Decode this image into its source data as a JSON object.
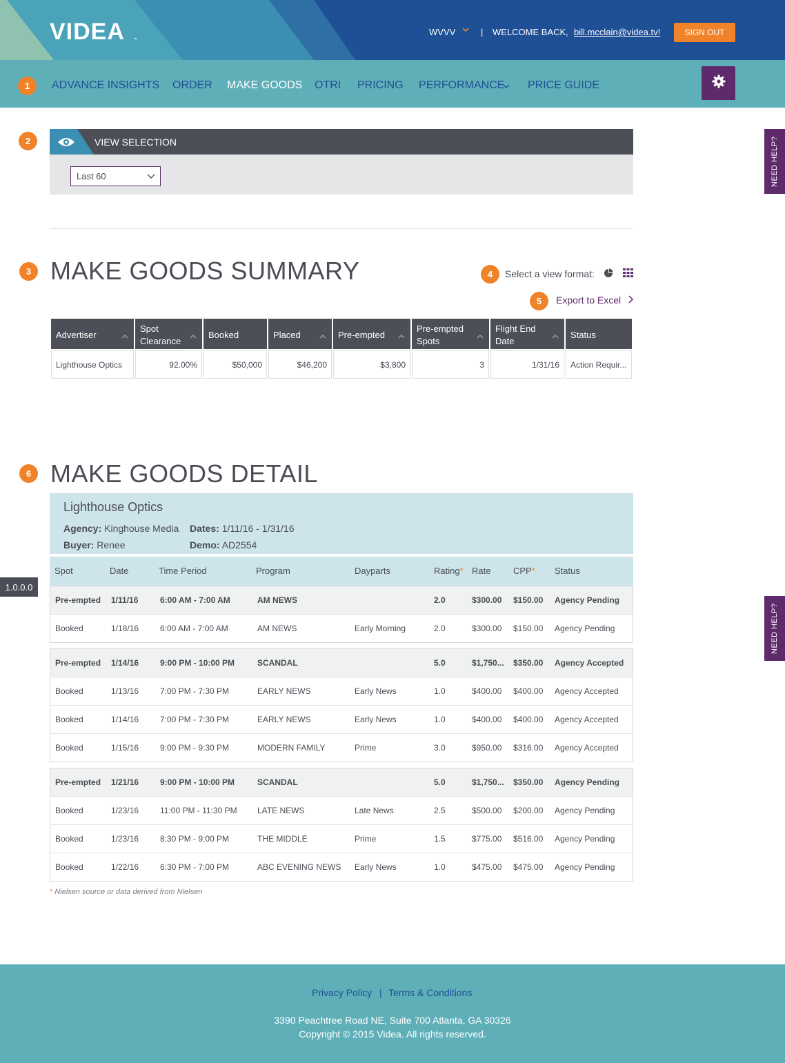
{
  "header": {
    "logo": "VIDEA",
    "logo_tm": "™",
    "station": "WVVV",
    "separator": "|",
    "welcome": "WELCOME BACK,",
    "email": "bill.mcclain@videa.tv!",
    "signout": "SIGN OUT"
  },
  "badges": [
    "1",
    "2",
    "3",
    "4",
    "5",
    "6"
  ],
  "nav": {
    "items": [
      {
        "label": "ADVANCE INSIGHTS"
      },
      {
        "label": "ORDER"
      },
      {
        "label": "MAKE GOODS"
      },
      {
        "label": "OTRI"
      },
      {
        "label": "PRICING"
      },
      {
        "label": "PERFORMANCE"
      },
      {
        "label": "PRICE GUIDE"
      }
    ],
    "active": "MAKE GOODS"
  },
  "help": {
    "label": "NEED HELP?"
  },
  "version": "1.0.0.0",
  "view_selection": {
    "title": "VIEW SELECTION",
    "selected": "Last 60"
  },
  "summary": {
    "title": "MAKE GOODS SUMMARY",
    "view_format_label": "Select a view format:",
    "export_label": "Export to Excel",
    "columns": [
      "Advertiser",
      "Spot Clearance",
      "Booked",
      "Placed",
      "Pre-empted",
      "Pre-empted Spots",
      "Flight End Date",
      "Status"
    ],
    "rows": [
      [
        "Lighthouse Optics",
        "92.00%",
        "$50,000",
        "$46,200",
        "$3,800",
        "3",
        "1/31/16",
        "Action Requir..."
      ]
    ]
  },
  "detail": {
    "title": "MAKE GOODS DETAIL",
    "advertiser": "Lighthouse Optics",
    "agency_label": "Agency:",
    "agency": "Kinghouse Media",
    "buyer_label": "Buyer:",
    "buyer": "Renee",
    "dates_label": "Dates:",
    "dates": "1/11/16 - 1/31/16",
    "demo_label": "Demo:",
    "demo": "AD2554",
    "columns": [
      "Spot",
      "Date",
      "Time Period",
      "Program",
      "Dayparts",
      "Rating",
      "Rate",
      "CPP",
      "Status"
    ],
    "star": "*",
    "groups": [
      [
        [
          "Pre-empted",
          "1/11/16",
          "6:00 AM - 7:00 AM",
          "AM NEWS",
          "",
          "2.0",
          "$300.00",
          "$150.00",
          "Agency Pending"
        ],
        [
          "Booked",
          "1/18/16",
          "6:00 AM - 7:00 AM",
          "AM NEWS",
          "Early Morning",
          "2.0",
          "$300.00",
          "$150.00",
          "Agency Pending"
        ]
      ],
      [
        [
          "Pre-empted",
          "1/14/16",
          "9:00 PM - 10:00 PM",
          "SCANDAL",
          "",
          "5.0",
          "$1,750...",
          "$350.00",
          "Agency Accepted"
        ],
        [
          "Booked",
          "1/13/16",
          "7:00 PM - 7:30 PM",
          "EARLY NEWS",
          "Early News",
          "1.0",
          "$400.00",
          "$400.00",
          "Agency Accepted"
        ],
        [
          "Booked",
          "1/14/16",
          "7:00 PM - 7:30 PM",
          "EARLY NEWS",
          "Early News",
          "1.0",
          "$400.00",
          "$400.00",
          "Agency Accepted"
        ],
        [
          "Booked",
          "1/15/16",
          "9:00 PM - 9:30 PM",
          "MODERN FAMILY",
          "Prime",
          "3.0",
          "$950.00",
          "$316.00",
          "Agency Accepted"
        ]
      ],
      [
        [
          "Pre-empted",
          "1/21/16",
          "9:00 PM - 10:00 PM",
          "SCANDAL",
          "",
          "5.0",
          "$1,750...",
          "$350.00",
          "Agency Pending"
        ],
        [
          "Booked",
          "1/23/16",
          "11:00 PM - 11:30 PM",
          "LATE NEWS",
          "Late News",
          "2.5",
          "$500.00",
          "$200.00",
          "Agency Pending"
        ],
        [
          "Booked",
          "1/23/16",
          "8:30 PM - 9:00 PM",
          "THE MIDDLE",
          "Prime",
          "1.5",
          "$775.00",
          "$516.00",
          "Agency Pending"
        ],
        [
          "Booked",
          "1/22/16",
          "6:30 PM - 7:00 PM",
          "ABC EVENING NEWS",
          "Early News",
          "1.0",
          "$475.00",
          "$475.00",
          "Agency Pending"
        ]
      ]
    ],
    "footnote": "Nielsen source or data derived from Nielsen"
  },
  "footer": {
    "privacy": "Privacy Policy",
    "separator": "|",
    "terms": "Terms & Conditions",
    "address": "3390 Peachtree Road NE, Suite 700 Atlanta, GA 30326",
    "copyright": "Copyright © 2015 Videa. All rights reserved."
  },
  "colors": {
    "accent_orange": "#f0832a",
    "brand_purple": "#5f2a6b",
    "nav_teal": "#5fafb9",
    "header_blue": "#1f4f94",
    "table_head": "#4c4f57"
  }
}
